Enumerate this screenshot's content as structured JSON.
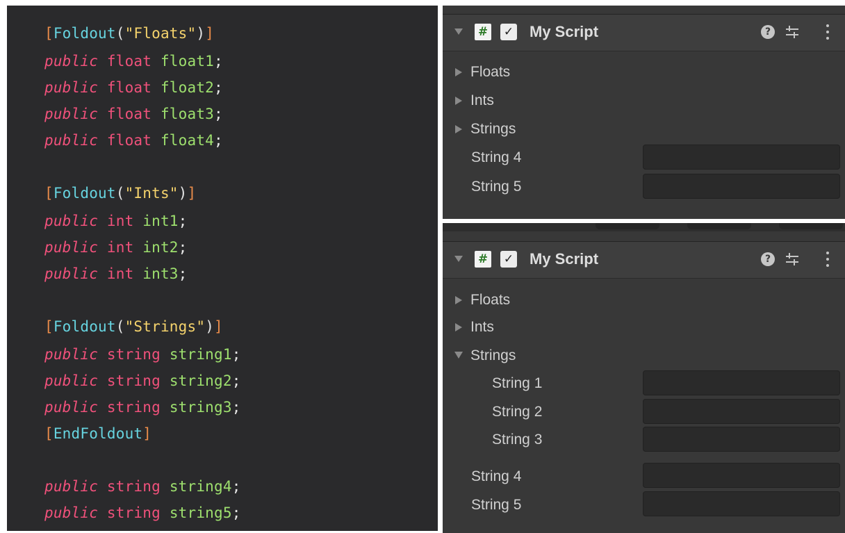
{
  "code": {
    "floats_section": {
      "attribute": "Foldout",
      "arg": "\"Floats\"",
      "lines": [
        {
          "modifier": "public",
          "type": "float",
          "name": "float1"
        },
        {
          "modifier": "public",
          "type": "float",
          "name": "float2"
        },
        {
          "modifier": "public",
          "type": "float",
          "name": "float3"
        },
        {
          "modifier": "public",
          "type": "float",
          "name": "float4"
        }
      ]
    },
    "ints_section": {
      "attribute": "Foldout",
      "arg": "\"Ints\"",
      "lines": [
        {
          "modifier": "public",
          "type": "int",
          "name": "int1"
        },
        {
          "modifier": "public",
          "type": "int",
          "name": "int2"
        },
        {
          "modifier": "public",
          "type": "int",
          "name": "int3"
        }
      ]
    },
    "strings_section": {
      "attribute": "Foldout",
      "arg": "\"Strings\"",
      "lines": [
        {
          "modifier": "public",
          "type": "string",
          "name": "string1"
        },
        {
          "modifier": "public",
          "type": "string",
          "name": "string2"
        },
        {
          "modifier": "public",
          "type": "string",
          "name": "string3"
        }
      ],
      "end_attribute": "EndFoldout"
    },
    "trailing_lines": [
      {
        "modifier": "public",
        "type": "string",
        "name": "string4"
      },
      {
        "modifier": "public",
        "type": "string",
        "name": "string5"
      }
    ]
  },
  "inspector_top": {
    "component_title": "My Script",
    "foldouts": [
      {
        "label": "Floats",
        "expanded": false
      },
      {
        "label": "Ints",
        "expanded": false
      },
      {
        "label": "Strings",
        "expanded": false
      }
    ],
    "fields": [
      {
        "label": "String 4",
        "value": ""
      },
      {
        "label": "String 5",
        "value": ""
      }
    ]
  },
  "inspector_bottom": {
    "component_title": "My Script",
    "foldouts": [
      {
        "label": "Floats",
        "expanded": false
      },
      {
        "label": "Ints",
        "expanded": false
      },
      {
        "label": "Strings",
        "expanded": true
      }
    ],
    "nested_fields": [
      {
        "label": "String 1",
        "value": ""
      },
      {
        "label": "String 2",
        "value": ""
      },
      {
        "label": "String 3",
        "value": ""
      }
    ],
    "fields": [
      {
        "label": "String 4",
        "value": ""
      },
      {
        "label": "String 5",
        "value": ""
      }
    ]
  },
  "icons": {
    "script": "csharp-script-icon",
    "enabled": "checkbox-checked-icon",
    "help": "help-icon",
    "presets": "settings-sliders-icon",
    "more": "more-vertical-icon"
  },
  "colors": {
    "editor_bg": "#2a2a2c",
    "inspector_bg": "#383838",
    "keyword": "#f0517b",
    "identifier": "#9ee06e",
    "attribute": "#67d4e0",
    "string_literal": "#f5d36c",
    "bracket": "#ea8c4a"
  }
}
